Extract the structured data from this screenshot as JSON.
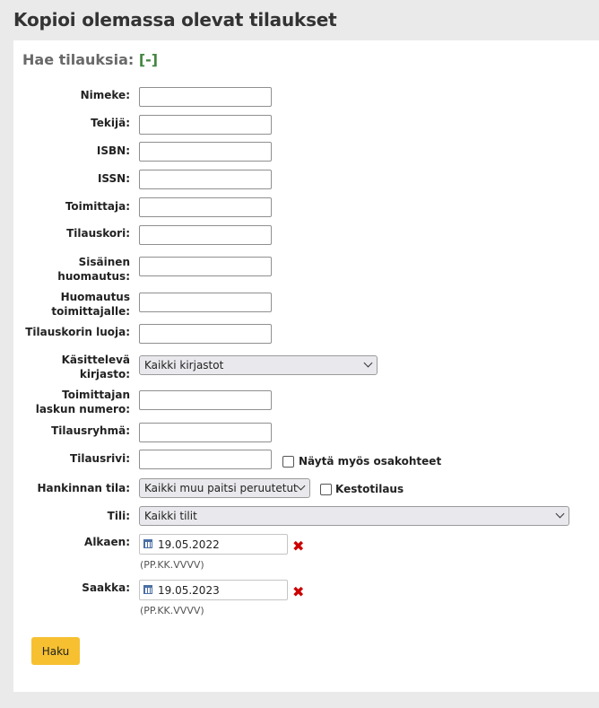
{
  "page_title": "Kopioi olemassa olevat tilaukset",
  "search_title": "Hae tilauksia:",
  "toggle": "[-]",
  "fields": {
    "title": {
      "label": "Nimeke:",
      "value": ""
    },
    "author": {
      "label": "Tekijä:",
      "value": ""
    },
    "isbn": {
      "label": "ISBN:",
      "value": ""
    },
    "issn": {
      "label": "ISSN:",
      "value": ""
    },
    "vendor": {
      "label": "Toimittaja:",
      "value": ""
    },
    "basket": {
      "label": "Tilauskori:",
      "value": ""
    },
    "internal_note": {
      "label": "Sisäinen huomautus:",
      "value": ""
    },
    "vendor_note": {
      "label": "Huomautus toimittajalle:",
      "value": ""
    },
    "basket_creator": {
      "label": "Tilauskorin luoja:",
      "value": ""
    },
    "branch": {
      "label": "Käsittelevä kirjasto:",
      "selected": "Kaikki kirjastot"
    },
    "invoice_number": {
      "label": "Toimittajan laskun numero:",
      "value": ""
    },
    "basket_group": {
      "label": "Tilausryhmä:",
      "value": ""
    },
    "order_line": {
      "label": "Tilausrivi:",
      "value": "",
      "checkbox_label": "Näytä myös osakohteet"
    },
    "status": {
      "label": "Hankinnan tila:",
      "selected": "Kaikki muu paitsi peruutetut",
      "checkbox_label": "Kestotilaus"
    },
    "fund": {
      "label": "Tili:",
      "selected": "Kaikki tilit"
    },
    "from": {
      "label": "Alkaen:",
      "value": "19.05.2022",
      "hint": "(PP.KK.VVVV)"
    },
    "to": {
      "label": "Saakka:",
      "value": "19.05.2023",
      "hint": "(PP.KK.VVVV)"
    }
  },
  "search_button": "Haku",
  "icons": {
    "calendar": "calendar-icon",
    "clear": "clear-date-icon"
  },
  "colors": {
    "button": "#f6c031",
    "toggle": "#408540",
    "clear": "#cc0000"
  }
}
